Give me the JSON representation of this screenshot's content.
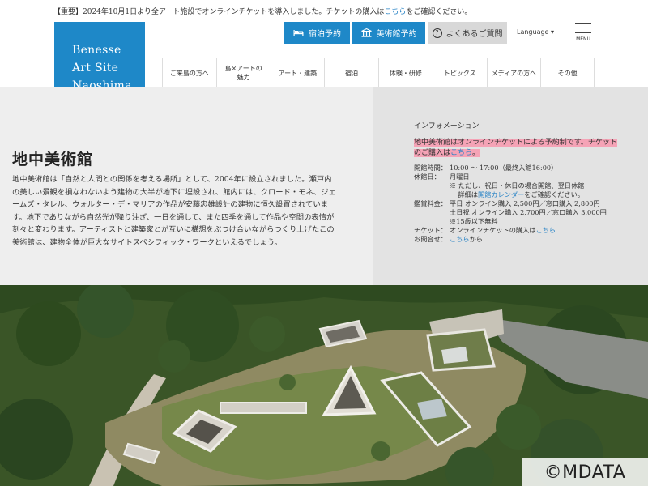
{
  "notice": {
    "text": "【重要】2024年10月1日より全アート施設でオンラインチケットを導入しました。チケットの購入は",
    "link": "こちら",
    "suffix": "をご確認ください。"
  },
  "logo": {
    "line1": "Benesse",
    "line2": "Art Site",
    "line3": "Naoshima"
  },
  "header": {
    "stay_label": "宿泊予約",
    "museum_label": "美術館予約",
    "faq_label": "よくあるご質問",
    "faq_icon_glyph": "?",
    "language_label": "Language ▾",
    "menu_label": "MENU"
  },
  "nav": {
    "items": [
      {
        "line1": "ご来島の方へ",
        "line2": ""
      },
      {
        "line1": "島×アートの",
        "line2": "魅力"
      },
      {
        "line1": "アート・建築",
        "line2": ""
      },
      {
        "line1": "宿泊",
        "line2": ""
      },
      {
        "line1": "体験・研修",
        "line2": ""
      },
      {
        "line1": "トピックス",
        "line2": ""
      },
      {
        "line1": "メディアの方へ",
        "line2": ""
      },
      {
        "line1": "その他",
        "line2": ""
      }
    ]
  },
  "main": {
    "title": "地中美術館",
    "description": "地中美術館は「自然と人間との関係を考える場所」として、2004年に設立されました。瀬戸内の美しい景観を損なわないよう建物の大半が地下に埋設され、館内には、クロード・モネ、ジェームズ・タレル、ウォルター・デ・マリアの作品が安藤忠雄設計の建物に恒久設置されています。地下でありながら自然光が降り注ぎ、一日を通して、また四季を通して作品や空間の表情が刻々と変わります。アーティストと建築家とが互いに構想をぶつけ合いながらつくり上げたこの美術館は、建物全体が巨大なサイトスペシフィック・ワークといえるでしょう。"
  },
  "info": {
    "title": "インフォメーション",
    "alert_text": "地中美術館はオンラインチケットによる予約制です。チケットのご購入は",
    "alert_link": "こちら",
    "alert_suffix": "。",
    "hours_label": "開館時間：",
    "hours_value": "10:00 ～ 17:00（最終入館16:00）",
    "closed_label": "休館日：",
    "closed_value": "月曜日",
    "closed_note1": "※ ただし、祝日・休日の場合開館、翌日休館",
    "closed_note2_prefix": "詳細は",
    "closed_note2_link": "開館カレンダー",
    "closed_note2_suffix": "をご確認ください。",
    "fee_label": "鑑賞料金：",
    "fee_weekday": "平日 オンライン購入 2,500円／窓口購入 2,800円",
    "fee_weekend": "土日祝 オンライン購入 2,700円／窓口購入 3,000円",
    "fee_note": "※15歳以下無料",
    "ticket_label": "チケット：",
    "ticket_prefix": "オンラインチケットの購入は",
    "ticket_link": "こちら",
    "contact_label": "お問合せ：",
    "contact_link": "こちら",
    "contact_suffix": "から"
  },
  "photo": {
    "copyright": "©MDATA"
  },
  "colors": {
    "brand_blue": "#1e88c8",
    "alert_pink": "#f5a3b6",
    "link_blue": "#2a84c6"
  }
}
